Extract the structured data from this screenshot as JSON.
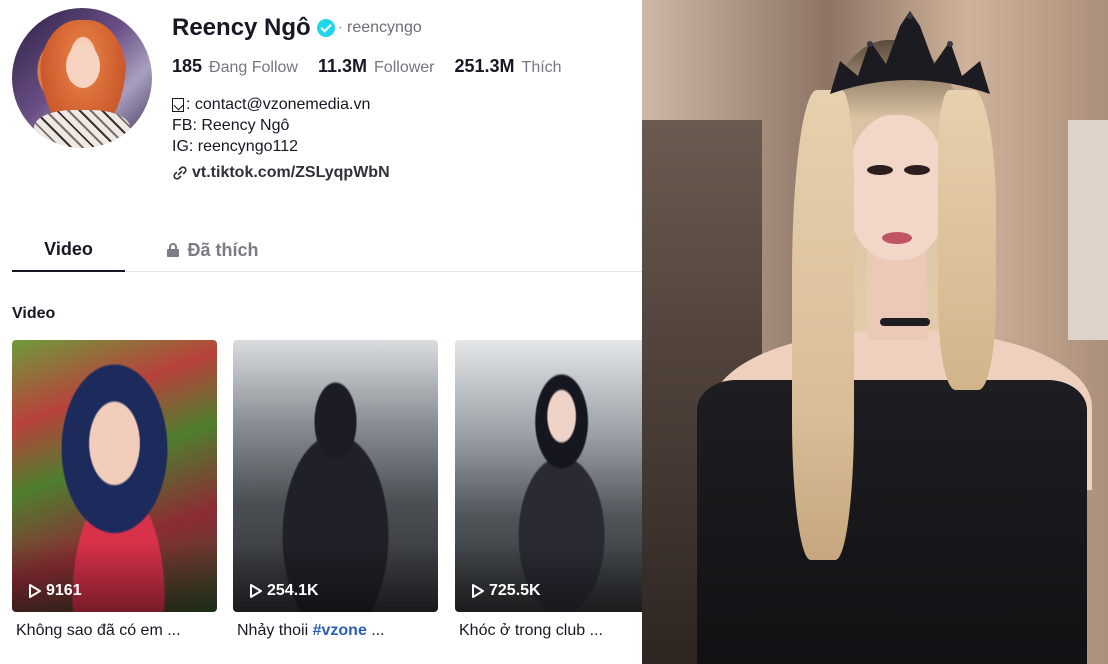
{
  "profile": {
    "name": "Reency Ngô",
    "separator": "·",
    "handle": "reencyngo",
    "verified": true,
    "stats": [
      {
        "value": "185",
        "label": "Đang Follow"
      },
      {
        "value": "11.3M",
        "label": "Follower"
      },
      {
        "value": "251.3M",
        "label": "Thích"
      }
    ],
    "bio": [
      ": contact@vzonemedia.vn",
      "FB: Reency Ngô",
      "IG: reencyngo112"
    ],
    "link": "vt.tiktok.com/ZSLyqpWbN"
  },
  "tabs": [
    {
      "label": "Video",
      "active": true
    },
    {
      "label": "Đã thích",
      "active": false,
      "icon": "lock-icon"
    }
  ],
  "section_title": "Video",
  "videos": [
    {
      "views": "9161",
      "caption": "Không sao đã có em ...",
      "caption_tag": ""
    },
    {
      "views": "254.1K",
      "caption": "Nhảy thoii ",
      "caption_tag": "#vzone",
      "caption_suffix": " ..."
    },
    {
      "views": "725.5K",
      "caption": "Khóc ở trong club ...",
      "caption_tag": ""
    }
  ],
  "colors": {
    "verified": "#20d5ec",
    "hashtag": "#2b5db9",
    "text_primary": "#161823",
    "text_secondary": "#757780"
  }
}
